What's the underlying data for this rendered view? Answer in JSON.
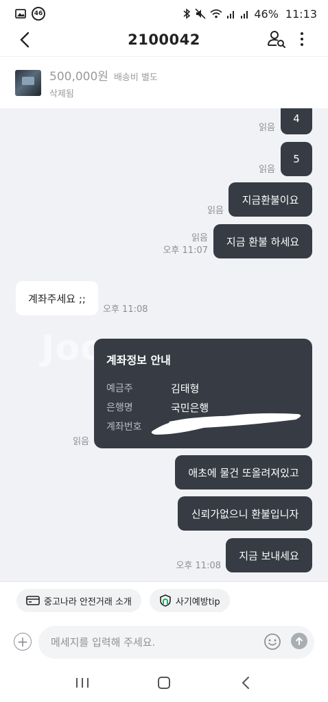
{
  "status_bar": {
    "network_badge": "46",
    "battery": "46%",
    "time": "11:13"
  },
  "header": {
    "title": "2100042"
  },
  "product": {
    "price": "500,000원",
    "shipping": "배송비 별도",
    "status": "삭제됨"
  },
  "messages": [
    {
      "side": "out",
      "text": "4",
      "read": "읽음",
      "time": ""
    },
    {
      "side": "out",
      "text": "5",
      "read": "읽음",
      "time": ""
    },
    {
      "side": "out",
      "text": "지금환불이요",
      "read": "읽음",
      "time": ""
    },
    {
      "side": "out",
      "text": "지금 환불 하세요",
      "read": "읽음",
      "time": "오후 11:07"
    },
    {
      "side": "in",
      "text": "계좌주세요 ;;",
      "time": "오후 11:08"
    },
    {
      "side": "out",
      "text": "애초에 물건 또올려져있고",
      "read": "",
      "time": ""
    },
    {
      "side": "out",
      "text": "신뢰가없으니 환불입니자",
      "read": "",
      "time": ""
    },
    {
      "side": "out",
      "text": "지금 보내세요",
      "read": "",
      "time": "오후 11:08"
    }
  ],
  "watermark": "Joonggonara",
  "account_card": {
    "title": "계좌정보 안내",
    "holder_label": "예금주",
    "holder_value": "김태형",
    "bank_label": "은행명",
    "bank_value": "국민은행",
    "number_label": "계좌번호",
    "read": "읽음"
  },
  "chips": {
    "safe_trade": "중고나라 안전거래 소개",
    "fraud_tip": "사기예방tip"
  },
  "composer": {
    "placeholder": "메세지를 입력해 주세요."
  },
  "colors": {
    "bubble_out": "#363b44",
    "bubble_in": "#ffffff",
    "chat_bg": "#f0f2f5"
  }
}
